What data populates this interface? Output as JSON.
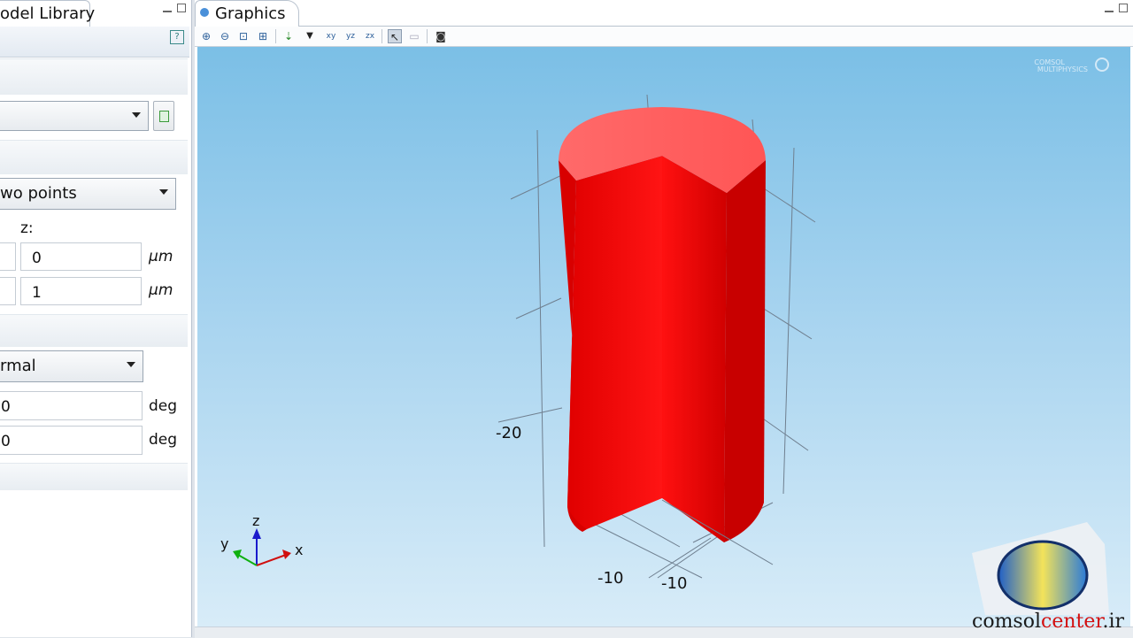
{
  "left_panel": {
    "tab_title": "odel Library",
    "selection_combo": "",
    "position_combo": "wo points",
    "z_label": "z:",
    "z_values": [
      "0",
      "1"
    ],
    "length_unit": "µm",
    "axis_combo": "rmal",
    "angle_values": [
      "0",
      "0"
    ],
    "angle_unit": "deg"
  },
  "graphics": {
    "tab_title": "Graphics",
    "logo_line1": "COMSOL",
    "logo_line2": "MULTIPHYSICS",
    "axis_labels": {
      "z_tick": "-20",
      "x_tick": "-10",
      "y_tick": "-10"
    },
    "triad": {
      "x": "x",
      "y": "y",
      "z": "z"
    },
    "toolbar_icons": [
      "zoom-in-icon",
      "zoom-out-icon",
      "zoom-box-icon",
      "zoom-extents-icon",
      "view-axis-icon",
      "dropdown-icon",
      "view-xy-icon",
      "view-yz-icon",
      "view-zx-icon",
      "select-icon",
      "scene-light-icon",
      "camera-icon"
    ]
  },
  "watermark": {
    "prefix": "comsol",
    "highlight": "center",
    "suffix": ".ir"
  },
  "colors": {
    "viewport_top": "#7bbfe6",
    "viewport_bottom": "#d8ecf8",
    "cylinder": "#ff1a1a",
    "cylinder_top": "#ff6a6a"
  }
}
